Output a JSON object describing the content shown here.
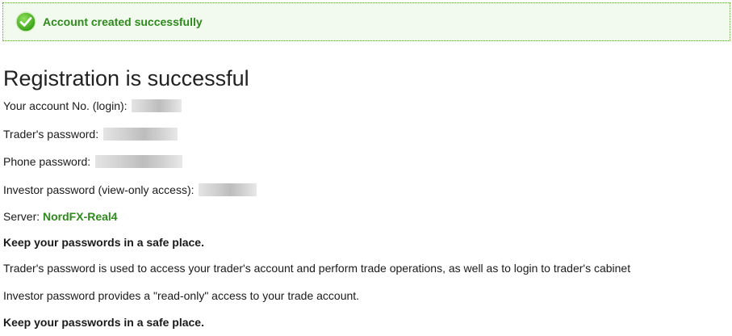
{
  "notice": {
    "text": "Account created successfully",
    "accent": "#2e8a1c",
    "icon": "checkmark-circle-icon"
  },
  "title": "Registration is successful",
  "account": {
    "login_label": "Your account No. (login):",
    "traders_password_label": "Trader's password:",
    "phone_password_label": "Phone password:",
    "investor_password_label": "Investor password (view-only access):",
    "server_label": "Server:",
    "server_value": "NordFX-Real4"
  },
  "notes": {
    "keep_safe_1": "Keep your passwords in a safe place.",
    "traders_info": "Trader's password is used to access your trader's account and perform trade operations, as well as to login to trader's cabinet",
    "investor_info": "Investor password provides a \"read-only\" access to your trade account.",
    "keep_safe_2": "Keep your passwords in a safe place."
  }
}
